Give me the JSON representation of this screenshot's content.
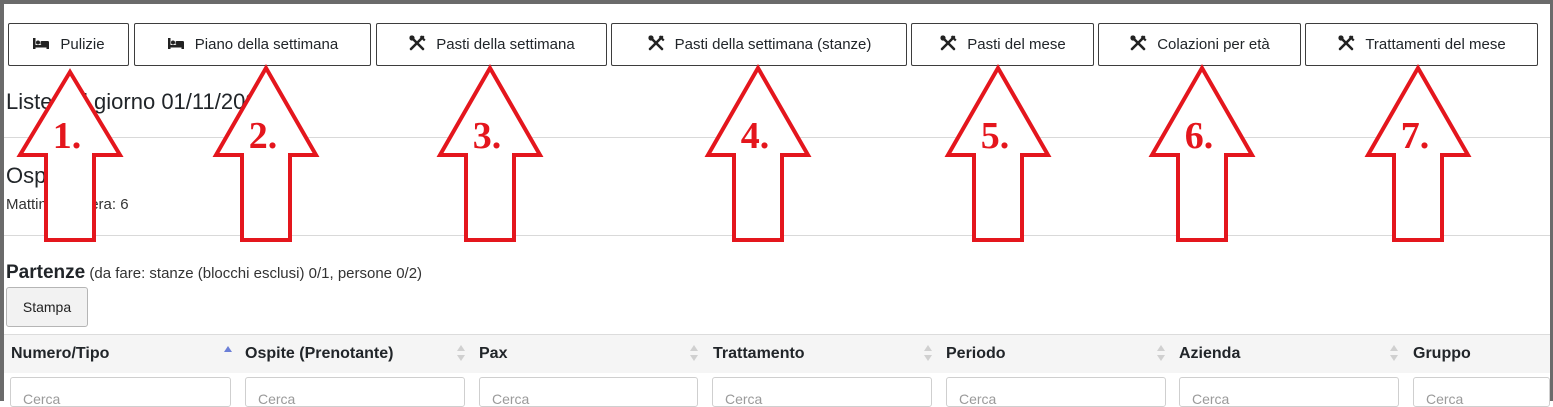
{
  "toolbar": {
    "buttons": [
      {
        "label": "Pulizie",
        "icon": "bed-icon"
      },
      {
        "label": "Piano della settimana",
        "icon": "bed-icon"
      },
      {
        "label": "Pasti della settimana",
        "icon": "utensils-icon"
      },
      {
        "label": "Pasti della settimana (stanze)",
        "icon": "utensils-icon"
      },
      {
        "label": "Pasti del mese",
        "icon": "utensils-icon"
      },
      {
        "label": "Colazioni per età",
        "icon": "utensils-icon"
      },
      {
        "label": "Trattamenti del mese",
        "icon": "utensils-icon"
      }
    ]
  },
  "page": {
    "title": "Liste del giorno 01/11/2021",
    "guests_title": "Ospiti",
    "meal_count": "Mattina: 6, Sera: 6"
  },
  "partenze": {
    "title": "Partenze",
    "detail": "(da fare: stanze (blocchi esclusi) 0/1, persone 0/2)",
    "print_label": "Stampa"
  },
  "table": {
    "columns": [
      "Numero/Tipo",
      "Ospite (Prenotante)",
      "Pax",
      "Trattamento",
      "Periodo",
      "Azienda",
      "Gruppo"
    ],
    "search_placeholder": "Cerca"
  },
  "annotations": {
    "arrow_color": "#e4161d",
    "labels": [
      "1.",
      "2.",
      "3.",
      "4.",
      "5.",
      "6.",
      "7."
    ]
  }
}
